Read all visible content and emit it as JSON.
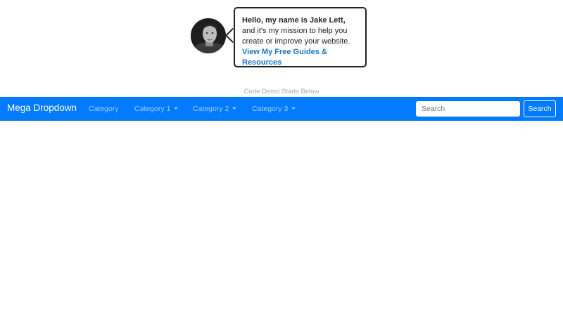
{
  "intro": {
    "greeting_bold": "Hello, my name is Jake Lett,",
    "greeting_rest": " and it's my mission to help you create or improve your website. ",
    "cta_link": "View My Free Guides & Resources"
  },
  "demo_label": "Code Demo Starts Below",
  "navbar": {
    "brand": "Mega Dropdown",
    "items": [
      {
        "label": "Category",
        "dropdown": false
      },
      {
        "label": "Category 1",
        "dropdown": true
      },
      {
        "label": "Category 2",
        "dropdown": true
      },
      {
        "label": "Category 3",
        "dropdown": true
      }
    ],
    "search": {
      "placeholder": "Search",
      "button_label": "Search"
    }
  },
  "colors": {
    "navbar_bg": "#007bff",
    "link_accent": "#1a73c9"
  }
}
